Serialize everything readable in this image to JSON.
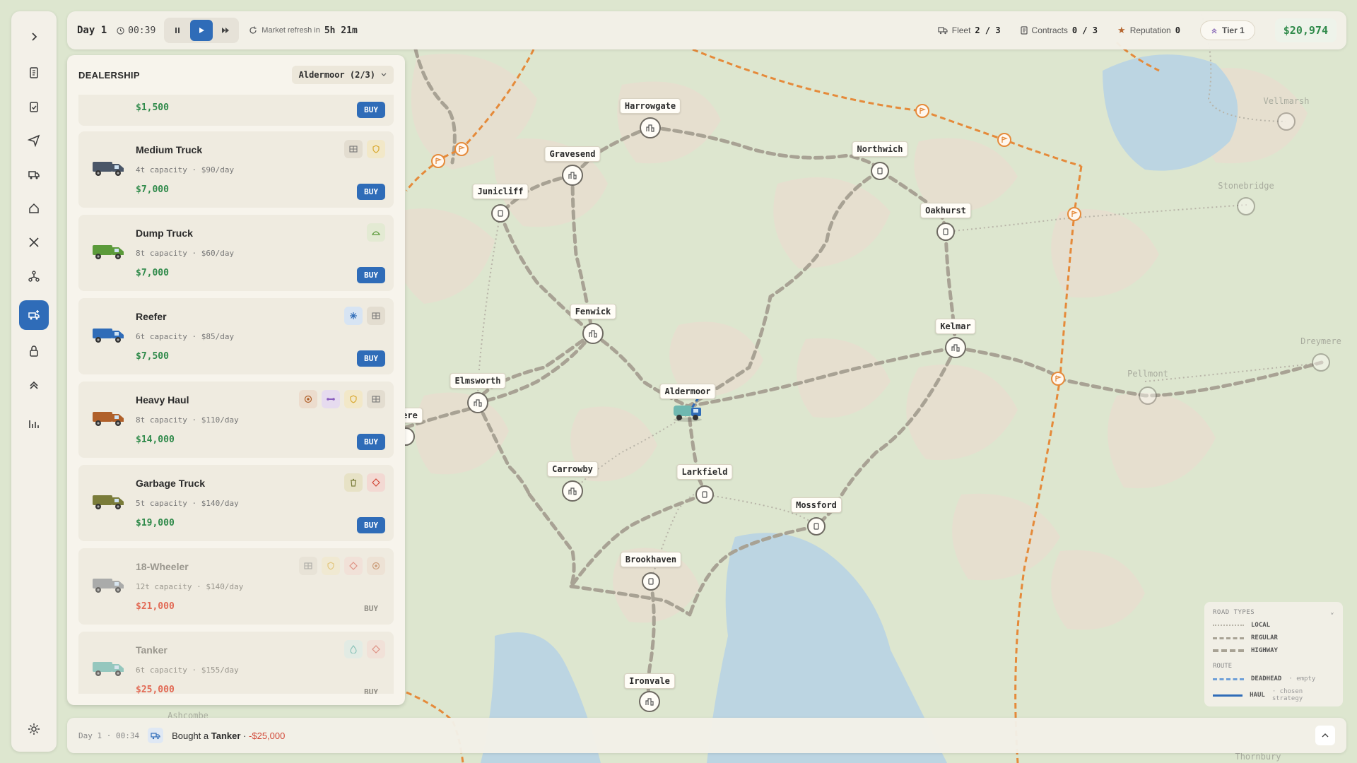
{
  "topbar": {
    "day": "Day 1",
    "clock": "00:39",
    "refresh_label": "Market refresh in",
    "refresh_value": "5h 21m",
    "fleet_label": "Fleet",
    "fleet_value": "2 / 3",
    "contracts_label": "Contracts",
    "contracts_value": "0 / 3",
    "reputation_label": "Reputation",
    "reputation_value": "0",
    "tier": "Tier 1",
    "money": "$20,974"
  },
  "panel": {
    "title": "DEALERSHIP",
    "city_select": "Aldermoor (2/3)",
    "partial_card_price": "$1,500",
    "buy_label": "BUY",
    "trucks": [
      {
        "name": "Medium Truck",
        "capacity": "4t capacity · $90/day",
        "price": "$7,000",
        "locked": false,
        "color": "#4a5668",
        "badges": [
          "grid-icon",
          "shield-icon"
        ]
      },
      {
        "name": "Dump Truck",
        "capacity": "8t capacity · $60/day",
        "price": "$7,000",
        "locked": false,
        "color": "#5b9a3a",
        "badges": [
          "mound-icon"
        ]
      },
      {
        "name": "Reefer",
        "capacity": "6t capacity · $85/day",
        "price": "$7,500",
        "locked": false,
        "color": "#2f6cb8",
        "badges": [
          "snowflake-icon",
          "grid-icon"
        ]
      },
      {
        "name": "Heavy Haul",
        "capacity": "8t capacity · $110/day",
        "price": "$14,000",
        "locked": false,
        "color": "#b0602a",
        "badges": [
          "target-icon",
          "bone-icon",
          "shield-icon",
          "grid-icon"
        ]
      },
      {
        "name": "Garbage Truck",
        "capacity": "5t capacity · $140/day",
        "price": "$19,000",
        "locked": false,
        "color": "#7a7c3a",
        "badges": [
          "trash-icon",
          "hazard-icon"
        ]
      },
      {
        "name": "18-Wheeler",
        "capacity": "12t capacity · $140/day",
        "price": "$21,000",
        "locked": true,
        "color": "#8e9194",
        "badges": [
          "grid-icon",
          "shield-icon",
          "hazard-icon",
          "target-icon"
        ]
      },
      {
        "name": "Tanker",
        "capacity": "6t capacity · $155/day",
        "price": "$25,000",
        "locked": true,
        "color": "#6fb8b0",
        "badges": [
          "drop-icon",
          "hazard-icon"
        ]
      }
    ]
  },
  "map": {
    "cities": [
      {
        "name": "Harrowgate",
        "big": true
      },
      {
        "name": "Gravesend",
        "big": true
      },
      {
        "name": "Junicliff",
        "big": false
      },
      {
        "name": "Northwich",
        "big": false
      },
      {
        "name": "Oakhurst",
        "big": false
      },
      {
        "name": "Fenwick",
        "big": true
      },
      {
        "name": "Elmsworth",
        "big": true
      },
      {
        "name": "Aldermoor",
        "big": true
      },
      {
        "name": "Kelmar",
        "big": true
      },
      {
        "name": "Carrowby",
        "big": true
      },
      {
        "name": "Larkfield",
        "big": false
      },
      {
        "name": "Mossford",
        "big": false
      },
      {
        "name": "Brookhaven",
        "big": false
      },
      {
        "name": "Ironvale",
        "big": true
      },
      {
        "name": "ere",
        "big": false
      }
    ],
    "faded_cities": [
      "Vellmarsh",
      "Stonebridge",
      "Dreymere",
      "Pellmont",
      "Ashcombe",
      "Thornbury"
    ]
  },
  "log": {
    "time": "Day 1 · 00:34",
    "text_prefix": "Bought a",
    "item": "Tanker",
    "separator": "·",
    "amount": "-$25,000"
  },
  "legend": {
    "title": "ROAD TYPES",
    "local": "LOCAL",
    "regular": "REGULAR",
    "highway": "HIGHWAY",
    "route_title": "ROUTE",
    "deadhead": "DEADHEAD",
    "deadhead_sub": "· empty",
    "haul": "HAUL",
    "haul_sub": "· chosen strategy"
  },
  "colors": {
    "accent": "#2f6cb8",
    "money": "#2f8a4a",
    "negative": "#d24a3a",
    "highway_orange": "#e58a3a"
  }
}
